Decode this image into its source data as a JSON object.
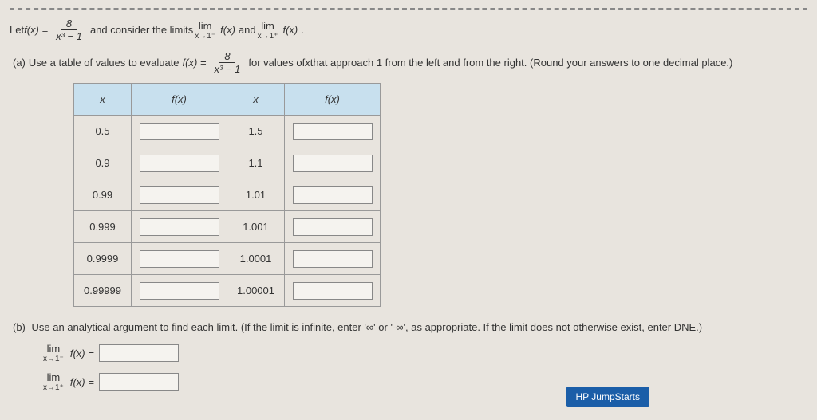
{
  "intro": {
    "let": "Let ",
    "fx_eq": "f(x) =",
    "frac_num": "8",
    "frac_den": "x³ − 1",
    "and_consider": " and consider the limits ",
    "lim_label": "lim",
    "lim_sub_left": "x→1⁻",
    "lim_sub_right": "x→1⁺",
    "fx": "f(x)",
    "and": " and ",
    "period": "."
  },
  "partA": {
    "label": "(a)",
    "text1": "Use a table of values to evaluate ",
    "fx_eq": "f(x) =",
    "frac_num": "8",
    "frac_den": "x³ − 1",
    "text2": " for values of ",
    "x": "x",
    "text3": " that approach 1 from the left and from the right. (Round your answers to one decimal place.)"
  },
  "table": {
    "h_x": "x",
    "h_fx": "f(x)",
    "left": [
      "0.5",
      "0.9",
      "0.99",
      "0.999",
      "0.9999",
      "0.99999"
    ],
    "right": [
      "1.5",
      "1.1",
      "1.01",
      "1.001",
      "1.0001",
      "1.00001"
    ]
  },
  "partB": {
    "label": "(b)",
    "text": "Use an analytical argument to find each limit. (If the limit is infinite, enter '∞' or '-∞', as appropriate. If the limit does not otherwise exist, enter DNE.)",
    "lim_label": "lim",
    "lim_sub_left": "x→1⁻",
    "lim_sub_right": "x→1⁺",
    "fx_eq": "f(x) ="
  },
  "button": {
    "hp": "HP JumpStarts"
  }
}
